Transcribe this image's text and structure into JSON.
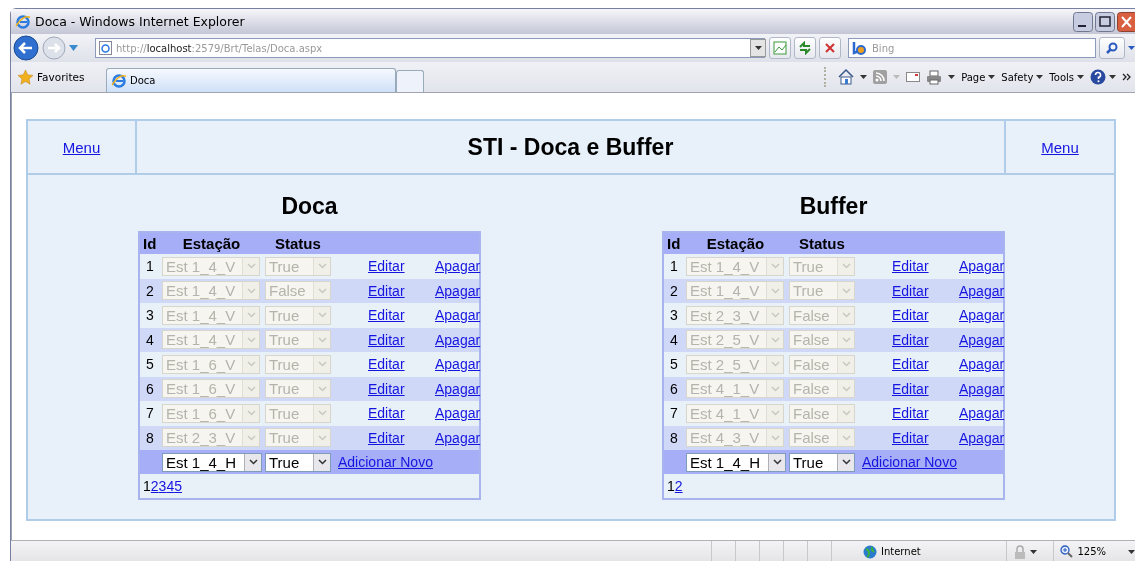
{
  "window": {
    "title": "Doca - Windows Internet Explorer"
  },
  "address_bar": {
    "url": "http://**localhost**:2579/Brt/Telas/Doca.aspx"
  },
  "search": {
    "placeholder": "Bing"
  },
  "favorites": {
    "label": "Favorites"
  },
  "tabs": [
    {
      "label": "Doca",
      "selected": true
    }
  ],
  "command_bar": [
    {
      "label": "Page"
    },
    {
      "label": "Safety"
    },
    {
      "label": "Tools"
    }
  ],
  "page": {
    "menu_left": "Menu",
    "title": "STI - Doca e Buffer",
    "menu_right": "Menu",
    "grids": [
      {
        "title": "Doca",
        "columns": [
          "Id",
          "Estação",
          "Status"
        ],
        "rows": [
          {
            "id": "1",
            "station": "Est 1_4_V",
            "status": "True",
            "disabled": true,
            "actions": [
              "Editar",
              "Apagar"
            ]
          },
          {
            "id": "2",
            "station": "Est 1_4_V",
            "status": "False",
            "disabled": true,
            "actions": [
              "Editar",
              "Apagar"
            ]
          },
          {
            "id": "3",
            "station": "Est 1_4_V",
            "status": "True",
            "disabled": true,
            "actions": [
              "Editar",
              "Apagar"
            ]
          },
          {
            "id": "4",
            "station": "Est 1_4_V",
            "status": "True",
            "disabled": true,
            "actions": [
              "Editar",
              "Apagar"
            ]
          },
          {
            "id": "5",
            "station": "Est 1_6_V",
            "status": "True",
            "disabled": true,
            "actions": [
              "Editar",
              "Apagar"
            ]
          },
          {
            "id": "6",
            "station": "Est 1_6_V",
            "status": "True",
            "disabled": true,
            "actions": [
              "Editar",
              "Apagar"
            ]
          },
          {
            "id": "7",
            "station": "Est 1_6_V",
            "status": "True",
            "disabled": true,
            "actions": [
              "Editar",
              "Apagar"
            ]
          },
          {
            "id": "8",
            "station": "Est 2_3_V",
            "status": "True",
            "disabled": true,
            "actions": [
              "Editar",
              "Apagar"
            ]
          }
        ],
        "insert": {
          "station": "Est 1_4_H",
          "status": "True",
          "disabled": false,
          "action": "Adicionar Novo"
        },
        "pages": [
          {
            "label": "1",
            "selected": true
          },
          {
            "label": "2",
            "selected": false
          },
          {
            "label": "3",
            "selected": false
          },
          {
            "label": "4",
            "selected": false
          },
          {
            "label": "5",
            "selected": false
          }
        ]
      },
      {
        "title": "Buffer",
        "columns": [
          "Id",
          "Estação",
          "Status"
        ],
        "rows": [
          {
            "id": "1",
            "station": "Est 1_4_V",
            "status": "True",
            "disabled": true,
            "actions": [
              "Editar",
              "Apagar"
            ]
          },
          {
            "id": "2",
            "station": "Est 1_4_V",
            "status": "True",
            "disabled": true,
            "actions": [
              "Editar",
              "Apagar"
            ]
          },
          {
            "id": "3",
            "station": "Est 2_3_V",
            "status": "False",
            "disabled": true,
            "actions": [
              "Editar",
              "Apagar"
            ]
          },
          {
            "id": "4",
            "station": "Est 2_5_V",
            "status": "False",
            "disabled": true,
            "actions": [
              "Editar",
              "Apagar"
            ]
          },
          {
            "id": "5",
            "station": "Est 2_5_V",
            "status": "False",
            "disabled": true,
            "actions": [
              "Editar",
              "Apagar"
            ]
          },
          {
            "id": "6",
            "station": "Est 4_1_V",
            "status": "False",
            "disabled": true,
            "actions": [
              "Editar",
              "Apagar"
            ]
          },
          {
            "id": "7",
            "station": "Est 4_1_V",
            "status": "False",
            "disabled": true,
            "actions": [
              "Editar",
              "Apagar"
            ]
          },
          {
            "id": "8",
            "station": "Est 4_3_V",
            "status": "False",
            "disabled": true,
            "actions": [
              "Editar",
              "Apagar"
            ]
          }
        ],
        "insert": {
          "station": "Est 1_4_H",
          "status": "True",
          "disabled": false,
          "action": "Adicionar Novo"
        },
        "pages": [
          {
            "label": "1",
            "selected": true
          },
          {
            "label": "2",
            "selected": false
          }
        ]
      }
    ]
  },
  "status_bar": {
    "zone": "Internet",
    "zoom": "125%"
  }
}
